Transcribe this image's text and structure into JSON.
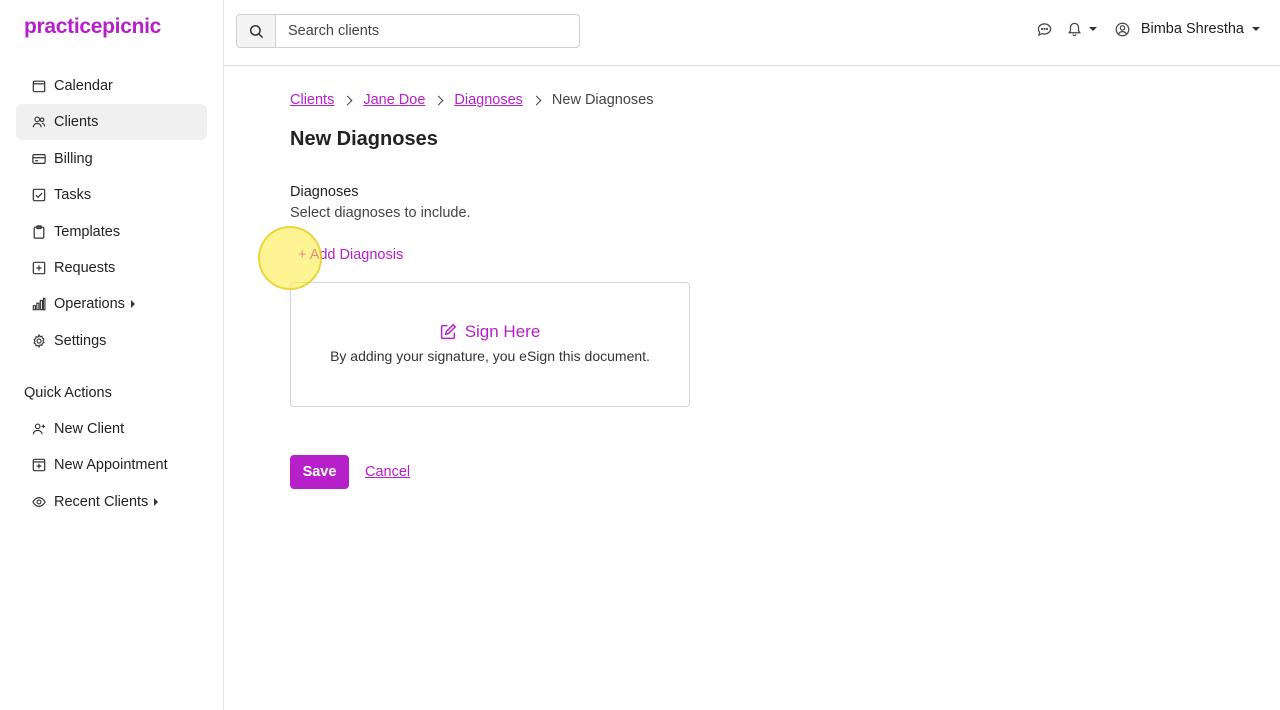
{
  "app": {
    "logo": "practicepicnic",
    "accent_color": "#b620c9"
  },
  "sidebar": {
    "items": [
      {
        "label": "Calendar",
        "icon": "calendar-icon"
      },
      {
        "label": "Clients",
        "icon": "users-icon",
        "active": true
      },
      {
        "label": "Billing",
        "icon": "credit-card-icon"
      },
      {
        "label": "Tasks",
        "icon": "checkbox-icon"
      },
      {
        "label": "Templates",
        "icon": "clipboard-icon"
      },
      {
        "label": "Requests",
        "icon": "plus-square-icon"
      },
      {
        "label": "Operations",
        "icon": "bar-chart-icon",
        "has_submenu": true
      },
      {
        "label": "Settings",
        "icon": "gear-icon"
      }
    ],
    "quick_actions_title": "Quick Actions",
    "quick_actions": [
      {
        "label": "New Client",
        "icon": "user-plus-icon"
      },
      {
        "label": "New Appointment",
        "icon": "calendar-plus-icon"
      },
      {
        "label": "Recent Clients",
        "icon": "eye-icon",
        "has_submenu": true
      }
    ]
  },
  "topbar": {
    "search_placeholder": "Search clients",
    "user_name": "Bimba Shrestha"
  },
  "main": {
    "breadcrumb": {
      "clients": "Clients",
      "client_name": "Jane Doe",
      "diagnoses": "Diagnoses",
      "current": "New Diagnoses"
    },
    "title": "New Diagnoses",
    "diagnoses_label": "Diagnoses",
    "diagnoses_help": "Select diagnoses to include.",
    "add_diagnosis": "+ Add Diagnosis",
    "sign_title": "Sign Here",
    "sign_subtitle": "By adding your signature, you eSign this document.",
    "save_label": "Save",
    "cancel_label": "Cancel"
  }
}
